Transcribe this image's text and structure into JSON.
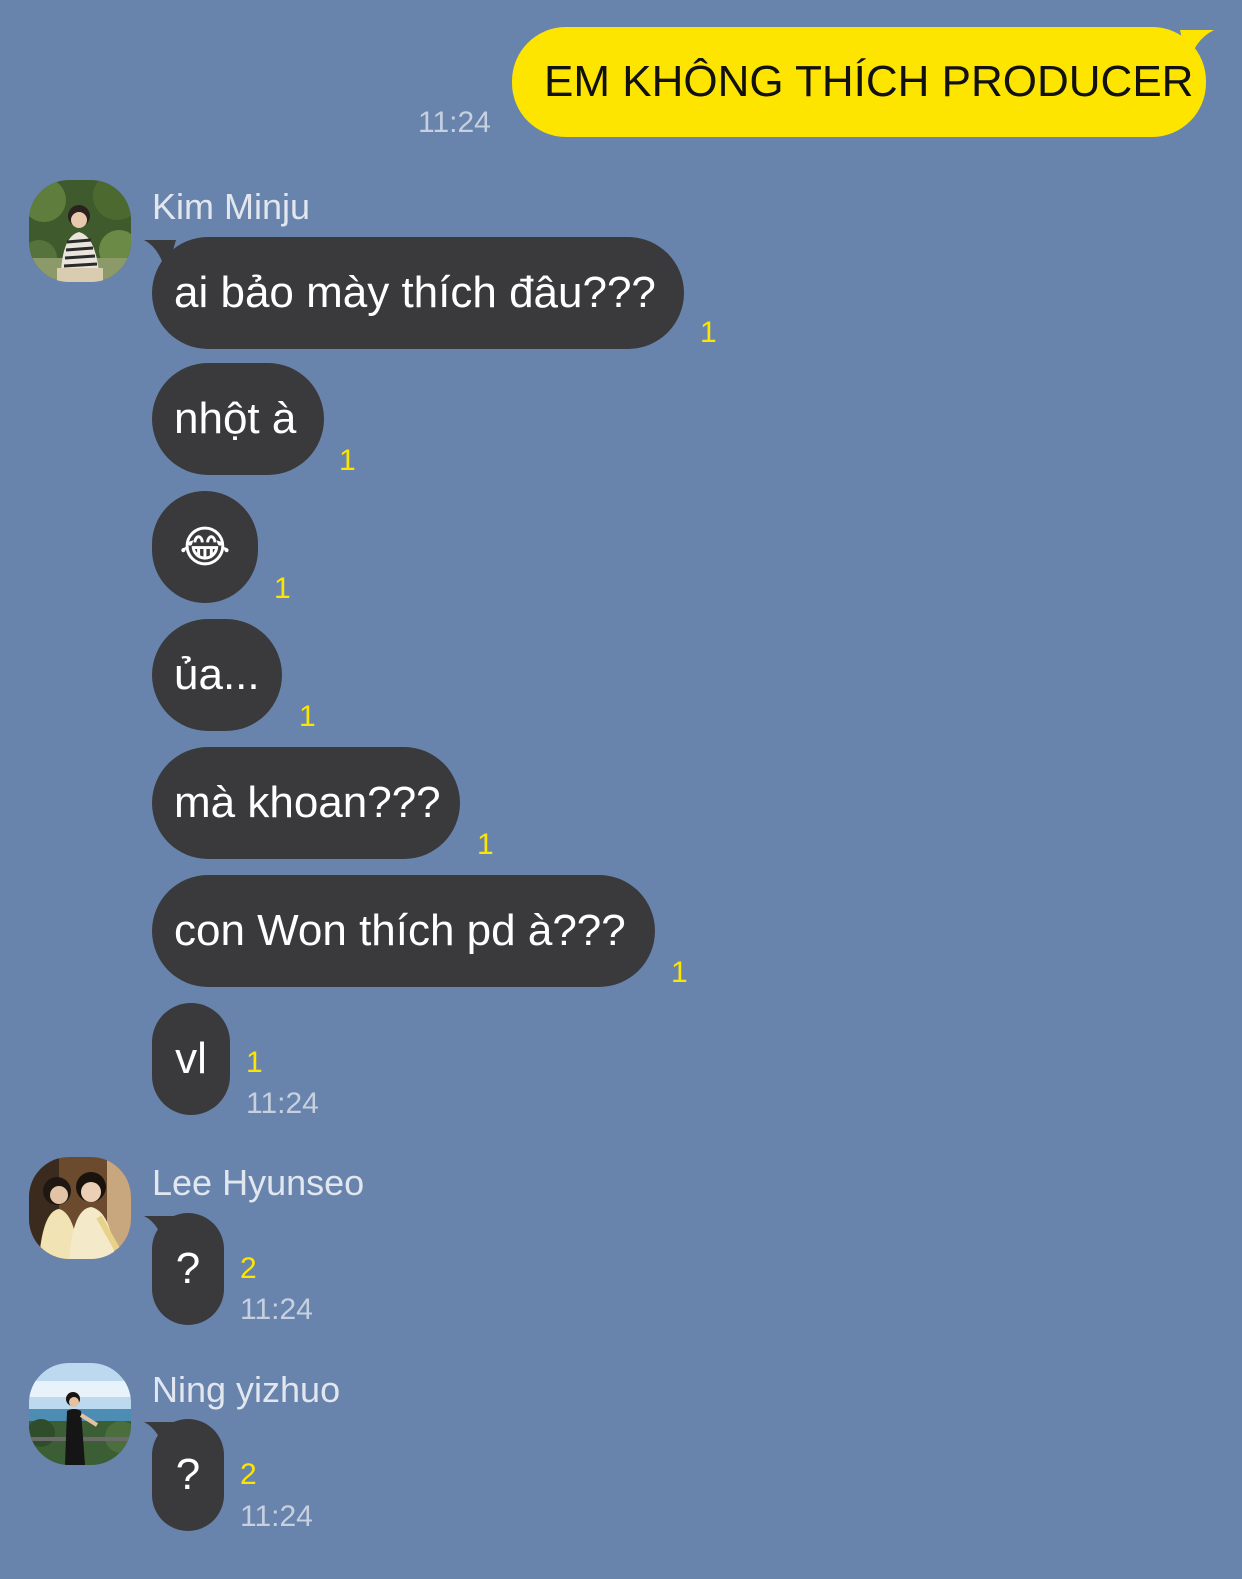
{
  "colors": {
    "background": "#6884ad",
    "outgoing_bubble": "#fee500",
    "incoming_bubble": "#3a3a3c",
    "unread_count": "#fee500",
    "timestamp": "#c6d0df",
    "sender_name": "#e2e7ef"
  },
  "outgoing": {
    "time": "11:24",
    "text": "EM KHÔNG THÍCH PRODUCER"
  },
  "groups": [
    {
      "sender": "Kim Minju",
      "avatar_icon": "profile-photo-garden",
      "time": "11:24",
      "messages": [
        {
          "text": "ai bảo mày thích đâu???",
          "unread": "1"
        },
        {
          "text": "nhột à",
          "unread": "1"
        },
        {
          "text": "😂",
          "unread": "1"
        },
        {
          "text": "ủa...",
          "unread": "1"
        },
        {
          "text": "mà khoan???",
          "unread": "1"
        },
        {
          "text": "con Won thích pd à???",
          "unread": "1"
        },
        {
          "text": "vl",
          "unread": "1"
        }
      ]
    },
    {
      "sender": "Lee Hyunseo",
      "avatar_icon": "profile-photo-two-people",
      "time": "11:24",
      "messages": [
        {
          "text": "?",
          "unread": "2"
        }
      ]
    },
    {
      "sender": "Ning yizhuo",
      "avatar_icon": "profile-photo-seaside",
      "time": "11:24",
      "messages": [
        {
          "text": "?",
          "unread": "2"
        }
      ]
    }
  ]
}
